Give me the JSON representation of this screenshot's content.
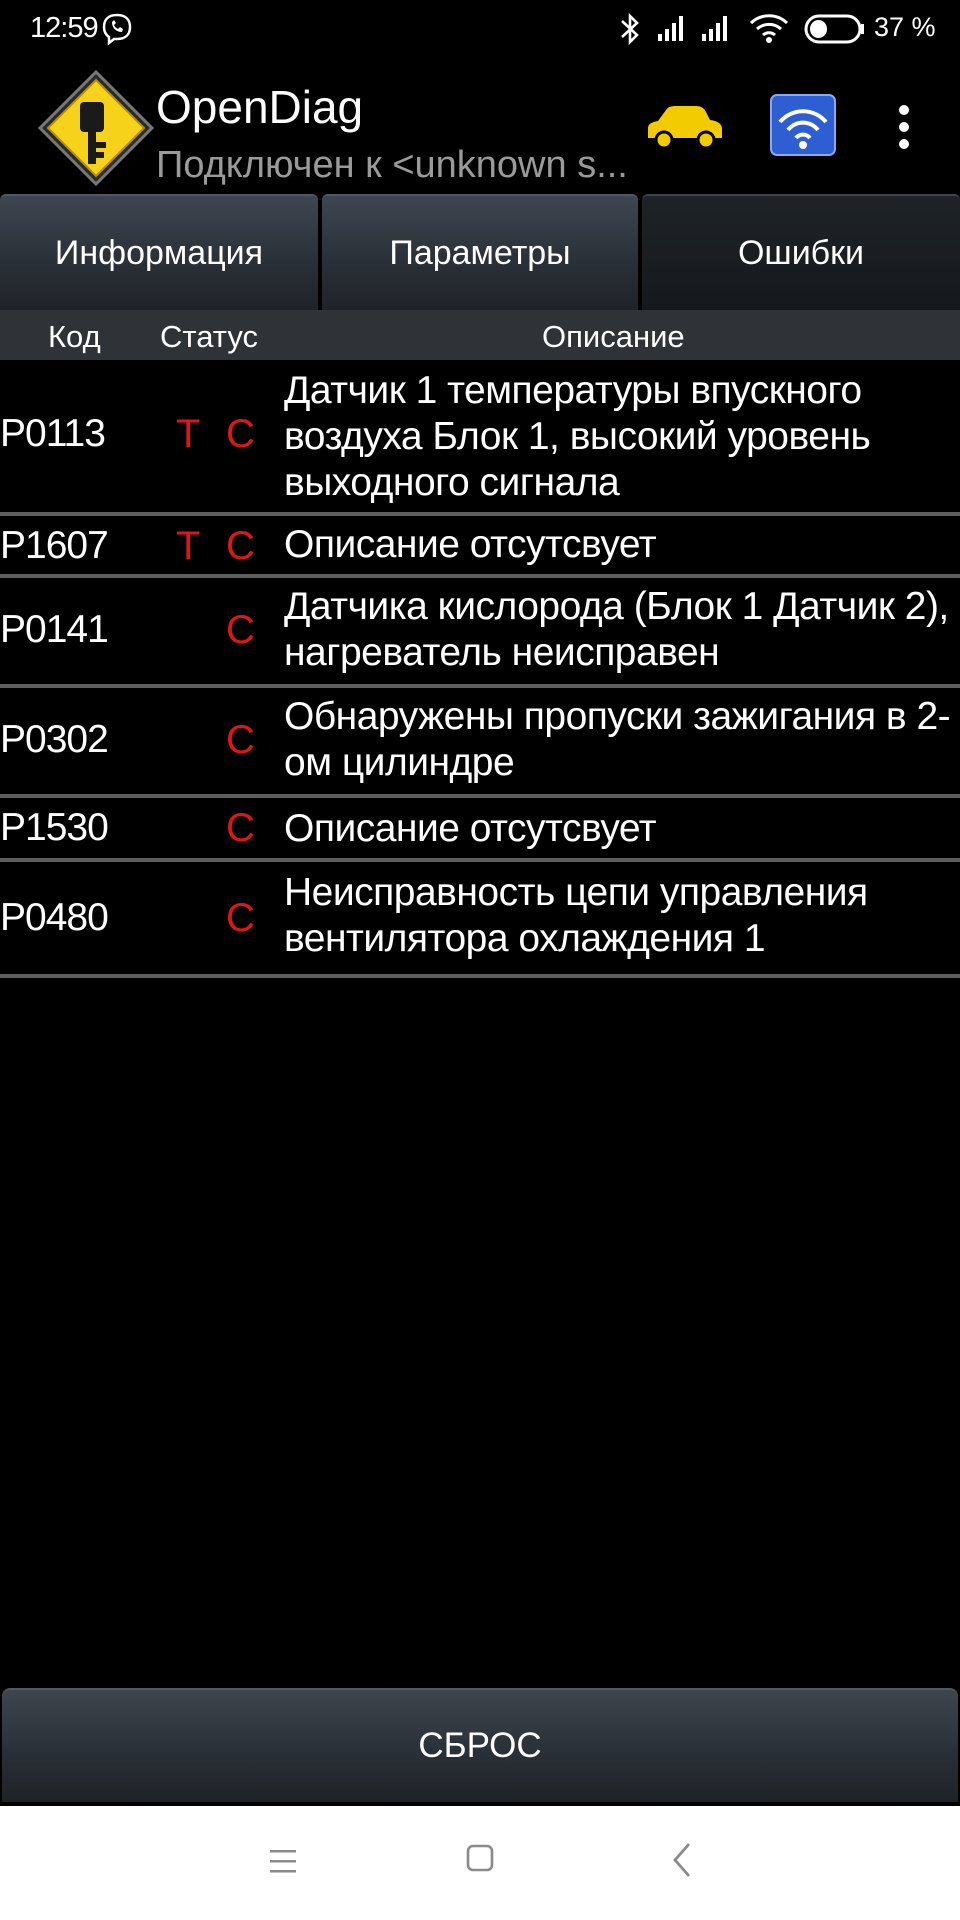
{
  "status_bar": {
    "time": "12:59",
    "battery_percent": "37 %",
    "battery_level": 37,
    "icons": [
      "viber-icon",
      "bluetooth-icon",
      "signal-icon",
      "signal-icon",
      "wifi-icon",
      "battery-icon"
    ]
  },
  "app_bar": {
    "title": "OpenDiag",
    "subtitle": "Подключен к <unknown s...",
    "icons": [
      "app-logo-icon",
      "car-icon",
      "elm327-wifi-icon",
      "more-vert-icon"
    ],
    "car_color": "#f2cb00"
  },
  "tabs": [
    {
      "label": "Информация",
      "active": false
    },
    {
      "label": "Параметры",
      "active": false
    },
    {
      "label": "Ошибки",
      "active": true
    }
  ],
  "table": {
    "headers": {
      "code": "Код",
      "status": "Статус",
      "description": "Описание"
    },
    "rows": [
      {
        "code": "P0113",
        "t": "T",
        "c": "C",
        "description": "Датчик 1 температуры впускного воздуха Блок 1, высокий уровень выходного сигнала"
      },
      {
        "code": "P1607",
        "t": "T",
        "c": "C",
        "description": "Описание отсутсвует"
      },
      {
        "code": "P0141",
        "t": "",
        "c": "C",
        "description": "Датчика кислорода (Блок 1 Датчик 2), нагреватель неисправен"
      },
      {
        "code": "P0302",
        "t": "",
        "c": "C",
        "description": "Обнаружены пропуски зажигания в 2-ом цилиндре"
      },
      {
        "code": "P1530",
        "t": "",
        "c": "C",
        "description": "Описание отсутсвует"
      },
      {
        "code": "P0480",
        "t": "",
        "c": "C",
        "description": "Неисправность цепи управления вентилятора охлаждения 1"
      }
    ]
  },
  "reset_button": {
    "label": "СБРОС"
  },
  "nav_bar": {
    "icons": [
      "recents-menu-icon",
      "home-icon",
      "back-icon"
    ]
  },
  "colors": {
    "status_red": "#e01515",
    "background": "#000000"
  }
}
